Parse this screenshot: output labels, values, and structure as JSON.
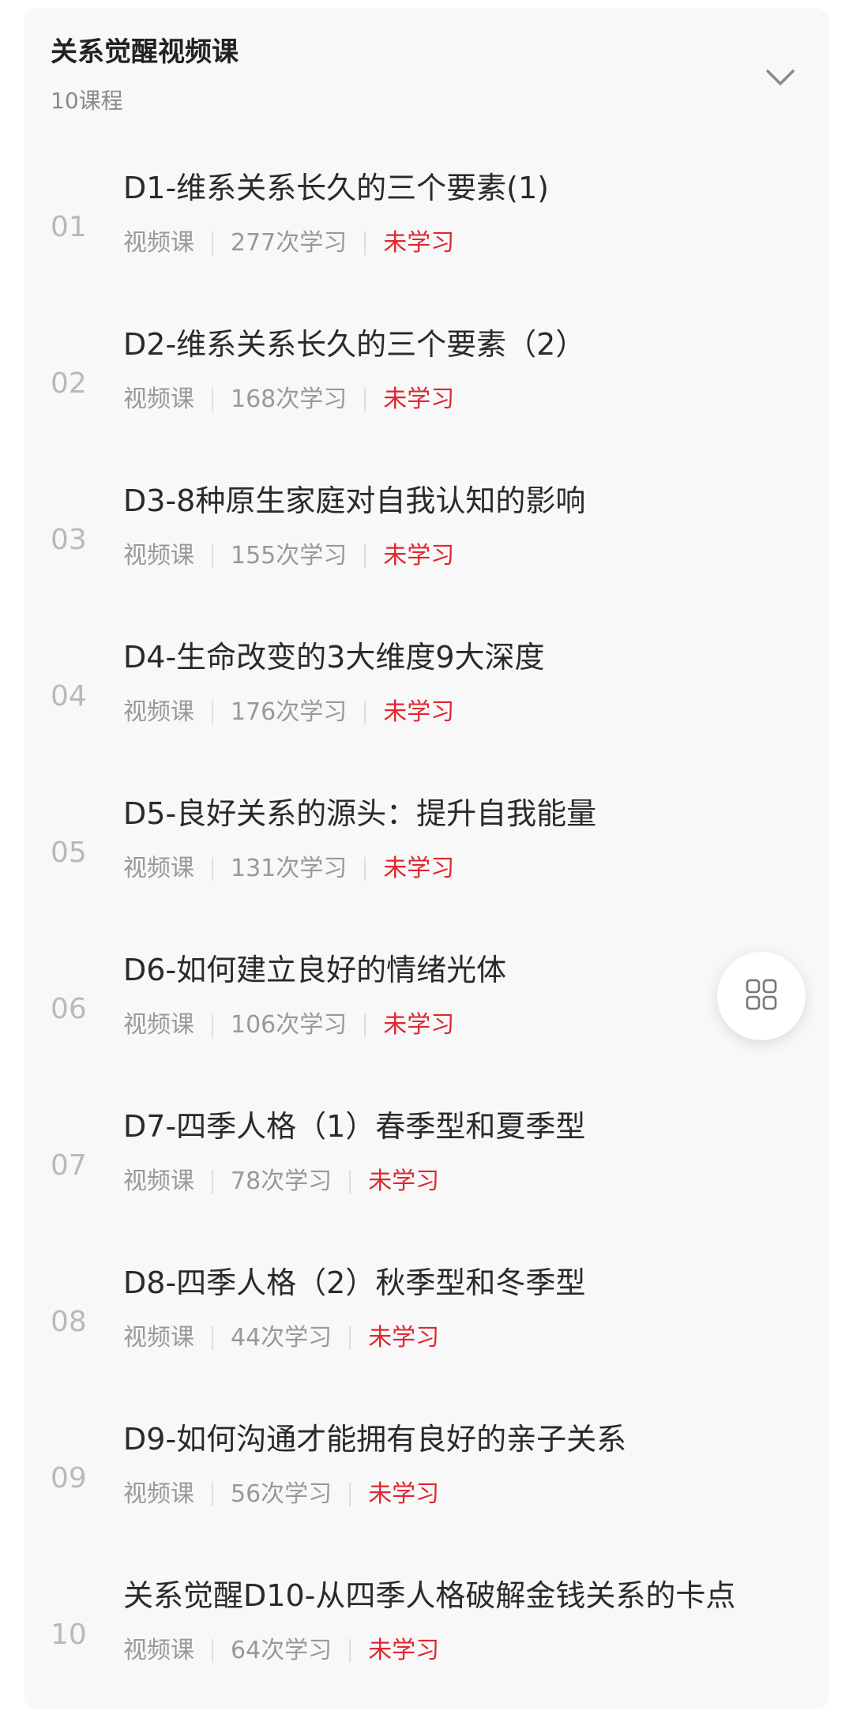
{
  "section": {
    "title": "关系觉醒视频课",
    "count": "10课程"
  },
  "icons": {
    "collapse": "chevron-down-icon",
    "float_menu": "grid-menu-icon"
  },
  "colors": {
    "status": "#e0262f",
    "muted": "#999999",
    "number": "#b9b9b9"
  },
  "lessons": [
    {
      "num": "01",
      "title": "D1-维系关系长久的三个要素(1)",
      "type": "视频课",
      "count": "277次学习",
      "status": "未学习"
    },
    {
      "num": "02",
      "title": "D2-维系关系长久的三个要素（2）",
      "type": "视频课",
      "count": "168次学习",
      "status": "未学习"
    },
    {
      "num": "03",
      "title": "D3-8种原生家庭对自我认知的影响",
      "type": "视频课",
      "count": "155次学习",
      "status": "未学习"
    },
    {
      "num": "04",
      "title": "D4-生命改变的3大维度9大深度",
      "type": "视频课",
      "count": "176次学习",
      "status": "未学习"
    },
    {
      "num": "05",
      "title": "D5-良好关系的源头：提升自我能量",
      "type": "视频课",
      "count": "131次学习",
      "status": "未学习"
    },
    {
      "num": "06",
      "title": "D6-如何建立良好的情绪光体",
      "type": "视频课",
      "count": "106次学习",
      "status": "未学习"
    },
    {
      "num": "07",
      "title": "D7-四季人格（1）春季型和夏季型",
      "type": "视频课",
      "count": "78次学习",
      "status": "未学习"
    },
    {
      "num": "08",
      "title": "D8-四季人格（2）秋季型和冬季型",
      "type": "视频课",
      "count": "44次学习",
      "status": "未学习"
    },
    {
      "num": "09",
      "title": "D9-如何沟通才能拥有良好的亲子关系",
      "type": "视频课",
      "count": "56次学习",
      "status": "未学习"
    },
    {
      "num": "10",
      "title": "关系觉醒D10-从四季人格破解金钱关系的卡点",
      "type": "视频课",
      "count": "64次学习",
      "status": "未学习"
    }
  ]
}
